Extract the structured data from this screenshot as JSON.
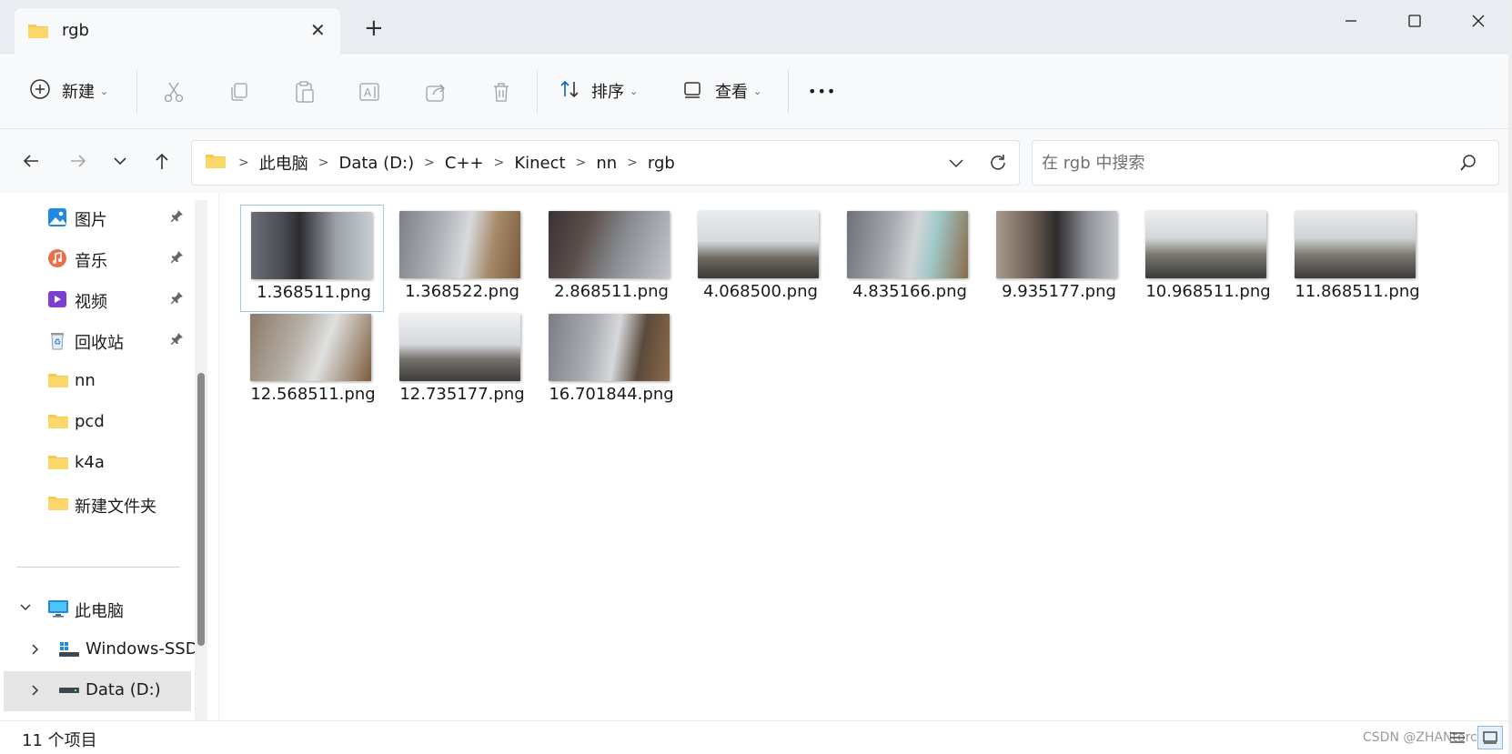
{
  "window": {
    "tab_title": "rgb",
    "new_tab_symbol": "+",
    "close_tab_symbol": "✕",
    "controls": [
      "minimize-icon",
      "maximize-icon",
      "close-icon"
    ]
  },
  "toolbar": {
    "new_label": "新建",
    "sort_label": "排序",
    "view_label": "查看",
    "more_label": "•••",
    "icons": [
      "cut-icon",
      "copy-icon",
      "paste-icon",
      "rename-icon",
      "share-icon",
      "delete-icon"
    ]
  },
  "address": {
    "breadcrumbs": [
      "此电脑",
      "Data (D:)",
      "C++",
      "Kinect",
      "nn",
      "rgb"
    ],
    "search_placeholder": "在 rgb 中搜索"
  },
  "sidebar": {
    "quick_access": [
      {
        "label": "图片",
        "icon": "pictures-icon",
        "pinned": true
      },
      {
        "label": "音乐",
        "icon": "music-icon",
        "pinned": true
      },
      {
        "label": "视频",
        "icon": "videos-icon",
        "pinned": true
      },
      {
        "label": "回收站",
        "icon": "recycle-bin-icon",
        "pinned": true
      },
      {
        "label": "nn",
        "icon": "folder-icon",
        "pinned": false
      },
      {
        "label": "pcd",
        "icon": "folder-icon",
        "pinned": false
      },
      {
        "label": "k4a",
        "icon": "folder-icon",
        "pinned": false
      },
      {
        "label": "新建文件夹",
        "icon": "folder-icon",
        "pinned": false
      }
    ],
    "this_pc_label": "此电脑",
    "drives": [
      {
        "label": "Windows-SSD",
        "icon": "drive-icon"
      },
      {
        "label": "Data (D:)",
        "icon": "drive-icon"
      }
    ]
  },
  "files": [
    {
      "name": "1.368511.png",
      "thumb": "person"
    },
    {
      "name": "1.368522.png",
      "thumb": "blur"
    },
    {
      "name": "2.868511.png",
      "thumb": "hands"
    },
    {
      "name": "4.068500.png",
      "thumb": "room"
    },
    {
      "name": "4.835166.png",
      "thumb": "blur"
    },
    {
      "name": "9.935177.png",
      "thumb": "person"
    },
    {
      "name": "10.968511.png",
      "thumb": "room"
    },
    {
      "name": "11.868511.png",
      "thumb": "room"
    },
    {
      "name": "12.568511.png",
      "thumb": "blur"
    },
    {
      "name": "12.735177.png",
      "thumb": "room"
    },
    {
      "name": "16.701844.png",
      "thumb": "blur"
    }
  ],
  "status": {
    "count_text": "11 个项目",
    "watermark": "CSDN @ZHANtorcal"
  },
  "colors": {
    "accent": "#0067c0",
    "folder": "#f7c948",
    "selection_border": "#99c9ef"
  }
}
